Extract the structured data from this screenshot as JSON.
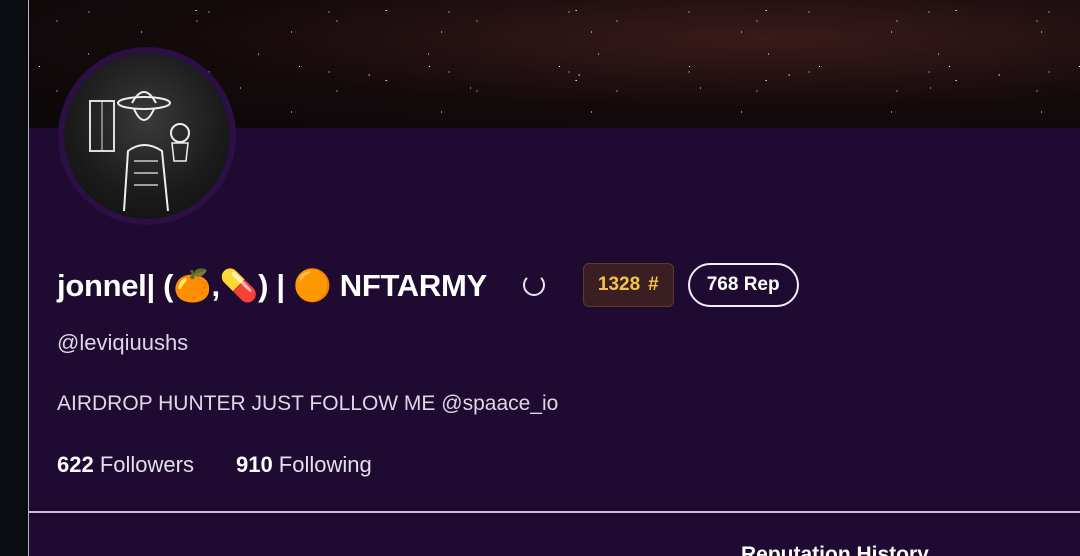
{
  "profile": {
    "display_name": "jonnel| (🍊,💊) | 🟠 NFTARMY",
    "handle": "@leviqiuushs",
    "bio": "AIRDROP HUNTER JUST FOLLOW ME @spaace_io",
    "rank_value": "1328",
    "rank_symbol": "#",
    "rep_label": "768 Rep",
    "followers_count": "622",
    "followers_label": "Followers",
    "following_count": "910",
    "following_label": "Following"
  },
  "sections": {
    "reputation_history_title": "Reputation History"
  },
  "colors": {
    "background": "#1f0a31",
    "rank_text": "#f6c34a",
    "rank_bg": "#3a1e22"
  },
  "icons": {
    "loading": "spinner-icon"
  }
}
